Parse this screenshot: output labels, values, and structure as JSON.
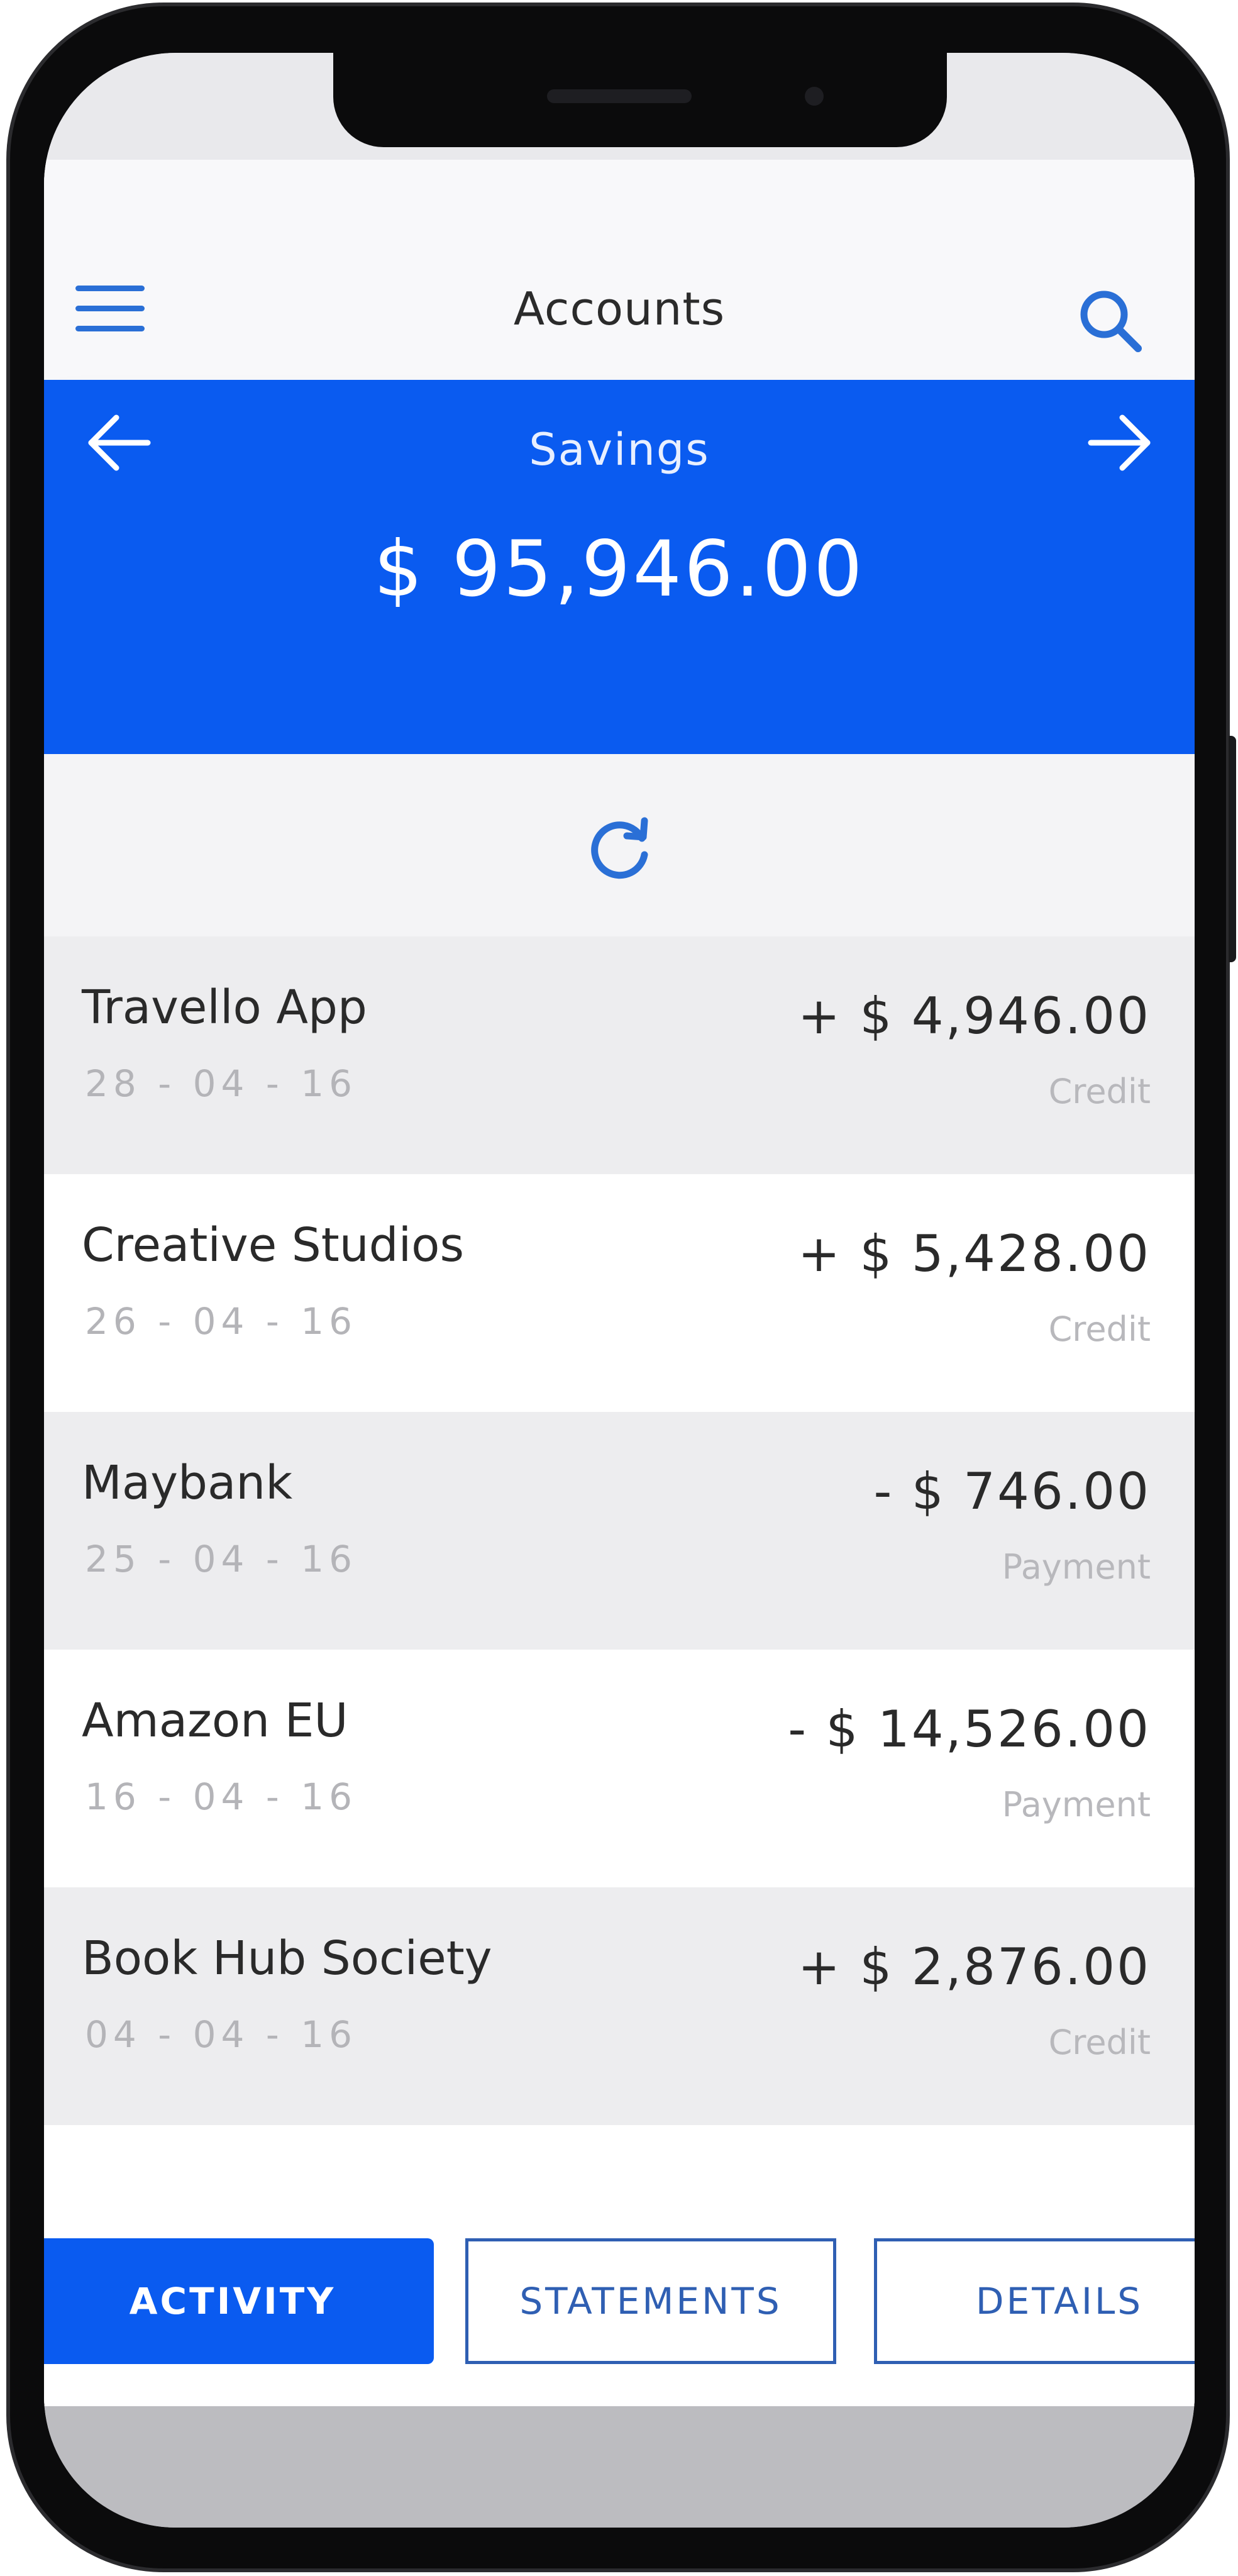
{
  "colors": {
    "accent": "#0a5bf0",
    "icon": "#2a6fd6",
    "outline": "#2f5fb3"
  },
  "navbar": {
    "title": "Accounts",
    "menu_icon": "hamburger-menu-icon",
    "search_icon": "search-icon"
  },
  "account": {
    "name": "Savings",
    "balance": "$ 95,946.00",
    "prev_icon": "arrow-left-icon",
    "next_icon": "arrow-right-icon"
  },
  "refresh_icon": "refresh-icon",
  "transactions": [
    {
      "name": "Travello App",
      "date": "28 - 04 - 16",
      "amount": "+ $ 4,946.00",
      "type": "Credit"
    },
    {
      "name": "Creative Studios",
      "date": "26 - 04 - 16",
      "amount": "+ $ 5,428.00",
      "type": "Credit"
    },
    {
      "name": "Maybank",
      "date": "25 - 04 - 16",
      "amount": "- $ 746.00",
      "type": "Payment"
    },
    {
      "name": "Amazon EU",
      "date": "16 - 04 - 16",
      "amount": "- $ 14,526.00",
      "type": "Payment"
    },
    {
      "name": "Book Hub Society",
      "date": "04 - 04 - 16",
      "amount": "+ $ 2,876.00",
      "type": "Credit"
    }
  ],
  "tabs": {
    "activity": "ACTIVITY",
    "statements": "STATEMENTS",
    "details": "DETAILS",
    "selected": "ACTIVITY"
  }
}
